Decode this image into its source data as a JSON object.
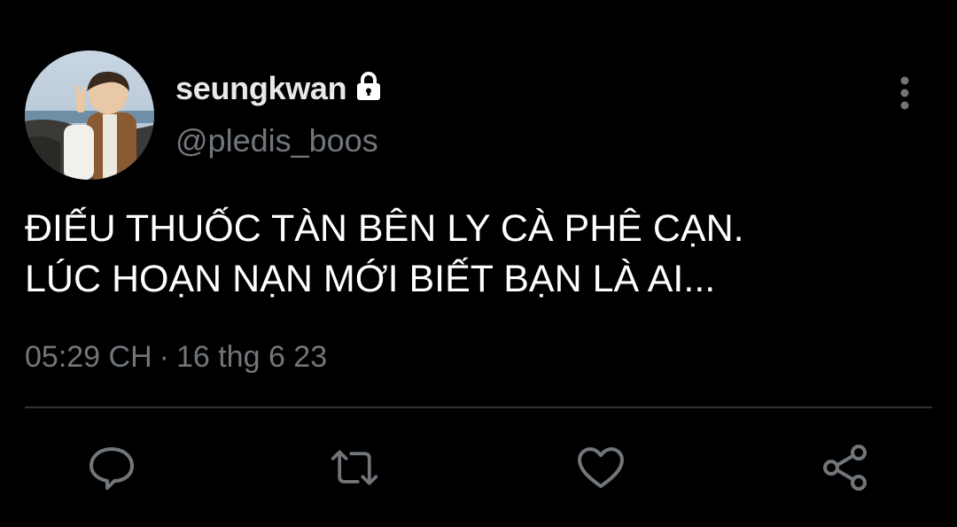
{
  "author": {
    "display_name": "seungkwan",
    "handle": "@pledis_boos",
    "protected_icon": "lock-icon",
    "avatar": "profile-photo"
  },
  "tweet": {
    "lines": [
      "ĐIẾU THUỐC TÀN BÊN LY CÀ PHÊ CẠN.",
      "LÚC HOẠN NẠN MỚI BIẾT BẠN LÀ AI..."
    ],
    "time": "05:29 CH",
    "separator": "·",
    "date": "16 thg 6 23"
  },
  "actions": [
    "reply-icon",
    "retweet-icon",
    "like-icon",
    "share-icon"
  ],
  "colors": {
    "background": "#000000",
    "primary_text": "#e7e9ea",
    "secondary_text": "#71767b",
    "divider": "#2f3336"
  }
}
